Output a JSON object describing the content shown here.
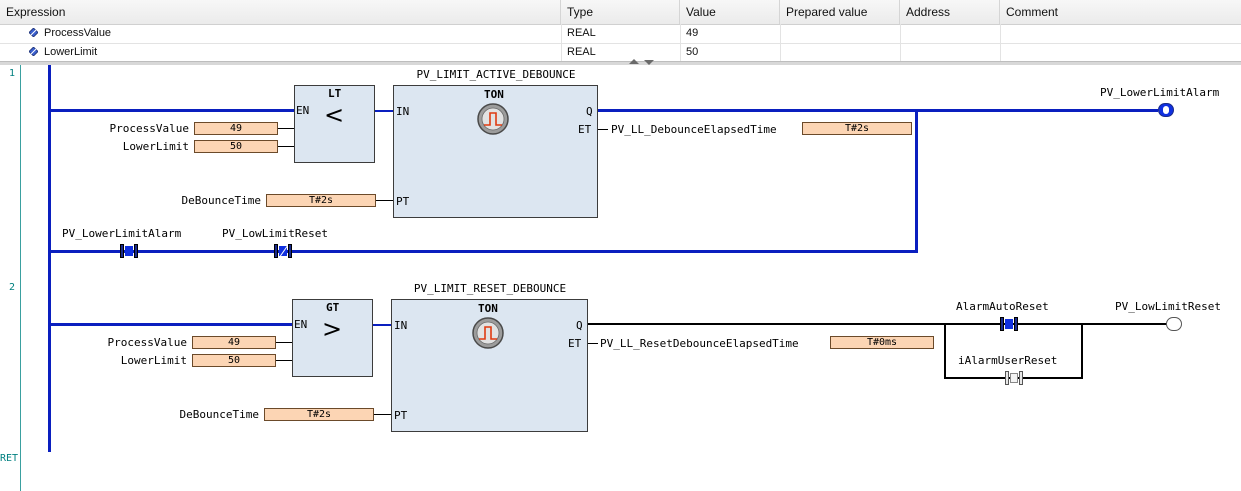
{
  "watch": {
    "headers": {
      "expression": "Expression",
      "type": "Type",
      "value": "Value",
      "prepared": "Prepared value",
      "address": "Address",
      "comment": "Comment"
    },
    "rows": [
      {
        "expression": "ProcessValue",
        "type": "REAL",
        "value": "49"
      },
      {
        "expression": "LowerLimit",
        "type": "REAL",
        "value": "50"
      }
    ]
  },
  "gutter": {
    "rung1": "1",
    "rung2": "2",
    "ret": "RET"
  },
  "rung1": {
    "compare_block": "LT",
    "compare_symbol": "<",
    "compare_en": "EN",
    "in1_label": "ProcessValue",
    "in1_value": "49",
    "in2_label": "LowerLimit",
    "in2_value": "50",
    "timer_instance": "PV_LIMIT_ACTIVE_DEBOUNCE",
    "timer_type": "TON",
    "pin_in": "IN",
    "pin_pt": "PT",
    "pin_q": "Q",
    "pin_et": "ET",
    "pt_label": "DeBounceTime",
    "pt_value": "T#2s",
    "et_label": "PV_LL_DebounceElapsedTime",
    "et_value": "T#2s",
    "coil_label": "PV_LowerLimitAlarm",
    "latch_contact_label": "PV_LowerLimitAlarm",
    "reset_contact_label": "PV_LowLimitReset"
  },
  "rung2": {
    "compare_block": "GT",
    "compare_symbol": ">",
    "compare_en": "EN",
    "in1_label": "ProcessValue",
    "in1_value": "49",
    "in2_label": "LowerLimit",
    "in2_value": "50",
    "timer_instance": "PV_LIMIT_RESET_DEBOUNCE",
    "timer_type": "TON",
    "pin_in": "IN",
    "pin_pt": "PT",
    "pin_q": "Q",
    "pin_et": "ET",
    "pt_label": "DeBounceTime",
    "pt_value": "T#2s",
    "et_label": "PV_LL_ResetDebounceElapsedTime",
    "et_value": "T#0ms",
    "auto_reset_label": "AlarmAutoReset",
    "user_reset_label": "iAlarmUserReset",
    "coil_label": "PV_LowLimitReset"
  },
  "colors": {
    "wire_active": "#0a1fbf",
    "wire_inactive": "#000000",
    "value_box": "#fcd5b4",
    "fb_fill": "#dce6f1",
    "gutter_text": "#008080"
  }
}
